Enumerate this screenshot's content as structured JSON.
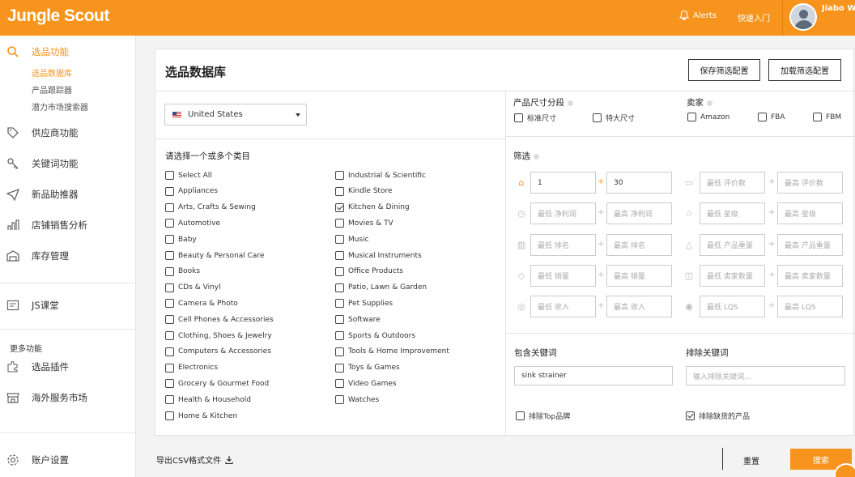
{
  "header": {
    "logo": "Jungle Scout",
    "alerts": "Alerts",
    "quick_start": "快速入门",
    "user_name": "Jiabo W"
  },
  "sidebar": {
    "product_functions": "选品功能",
    "sub_items": [
      "选品数据库",
      "产品跟踪器",
      "潜力市场搜索器"
    ],
    "items": [
      "供应商功能",
      "关键词功能",
      "新品助推器",
      "店铺销售分析",
      "库存管理"
    ],
    "course": "JS课堂",
    "more_label": "更多功能",
    "more_items": [
      "选品插件",
      "海外服务市场"
    ],
    "account": "账户设置"
  },
  "main": {
    "title": "选品数据库",
    "save_filter": "保存筛选配置",
    "load_filter": "加载筛选配置",
    "country": "United States",
    "categories_title": "请选择一个或多个类目",
    "categories_left": [
      {
        "label": "Select All",
        "checked": false
      },
      {
        "label": "Appliances",
        "checked": false
      },
      {
        "label": "Arts, Crafts & Sewing",
        "checked": false
      },
      {
        "label": "Automotive",
        "checked": false
      },
      {
        "label": "Baby",
        "checked": false
      },
      {
        "label": "Beauty & Personal Care",
        "checked": false
      },
      {
        "label": "Books",
        "checked": false
      },
      {
        "label": "CDs & Vinyl",
        "checked": false
      },
      {
        "label": "Camera & Photo",
        "checked": false
      },
      {
        "label": "Cell Phones & Accessories",
        "checked": false
      },
      {
        "label": "Clothing, Shoes & Jewelry",
        "checked": false
      },
      {
        "label": "Computers & Accessories",
        "checked": false
      },
      {
        "label": "Electronics",
        "checked": false
      },
      {
        "label": "Grocery & Gourmet Food",
        "checked": false
      },
      {
        "label": "Health & Household",
        "checked": false
      },
      {
        "label": "Home & Kitchen",
        "checked": false
      }
    ],
    "categories_right": [
      {
        "label": "Industrial & Scientific",
        "checked": false
      },
      {
        "label": "Kindle Store",
        "checked": false
      },
      {
        "label": "Kitchen & Dining",
        "checked": true
      },
      {
        "label": "Movies & TV",
        "checked": false
      },
      {
        "label": "Music",
        "checked": false
      },
      {
        "label": "Musical Instruments",
        "checked": false
      },
      {
        "label": "Office Products",
        "checked": false
      },
      {
        "label": "Patio, Lawn & Garden",
        "checked": false
      },
      {
        "label": "Pet Supplies",
        "checked": false
      },
      {
        "label": "Software",
        "checked": false
      },
      {
        "label": "Sports & Outdoors",
        "checked": false
      },
      {
        "label": "Tools & Home Improvement",
        "checked": false
      },
      {
        "label": "Toys & Games",
        "checked": false
      },
      {
        "label": "Video Games",
        "checked": false
      },
      {
        "label": "Watches",
        "checked": false
      }
    ],
    "size_tier_title": "产品尺寸分段",
    "size_tiers": [
      {
        "label": "标准尺寸",
        "checked": false
      },
      {
        "label": "特大尺寸",
        "checked": false
      }
    ],
    "seller_title": "卖家",
    "sellers": [
      {
        "label": "Amazon",
        "checked": false
      },
      {
        "label": "FBA",
        "checked": false
      },
      {
        "label": "FBM",
        "checked": false
      }
    ],
    "filters_title": "筛选",
    "filters_left": [
      {
        "icon": "price-tag-icon",
        "min": "1",
        "max": "30",
        "active": true
      },
      {
        "icon": "clock-icon",
        "min": "最低 净利润",
        "max": "最高 净利润",
        "active": false
      },
      {
        "icon": "bar-chart-icon",
        "min": "最低 排名",
        "max": "最高 排名",
        "active": false
      },
      {
        "icon": "tag-icon",
        "min": "最低 销量",
        "max": "最高 销量",
        "active": false
      },
      {
        "icon": "dollar-icon",
        "min": "最低 收入",
        "max": "最高 收入",
        "active": false
      }
    ],
    "filters_right": [
      {
        "icon": "review-icon",
        "min": "最低 评价数",
        "max": "最高 评价数",
        "active": false
      },
      {
        "icon": "star-icon",
        "min": "最低 星级",
        "max": "最高 星级",
        "active": false
      },
      {
        "icon": "weight-icon",
        "min": "最低 产品重量",
        "max": "最高 产品重量",
        "active": false
      },
      {
        "icon": "people-icon",
        "min": "最低 卖家数量",
        "max": "最高 卖家数量",
        "active": false
      },
      {
        "icon": "lqs-icon",
        "min": "最低 LQS",
        "max": "最高 LQS",
        "active": false
      }
    ],
    "include_keywords_title": "包含关键词",
    "include_keywords_value": "sink strainer",
    "exclude_keywords_title": "排除关键词",
    "exclude_keywords_placeholder": "输入排除关键词...",
    "exclude_top_brands": {
      "label": "排除Top品牌",
      "checked": false
    },
    "exclude_unavailable": {
      "label": "排除缺货的产品",
      "checked": true
    }
  },
  "footer": {
    "export_csv": "导出CSV格式文件",
    "reset": "重置",
    "search": "搜索"
  },
  "colors": {
    "accent": "#f7941d"
  }
}
